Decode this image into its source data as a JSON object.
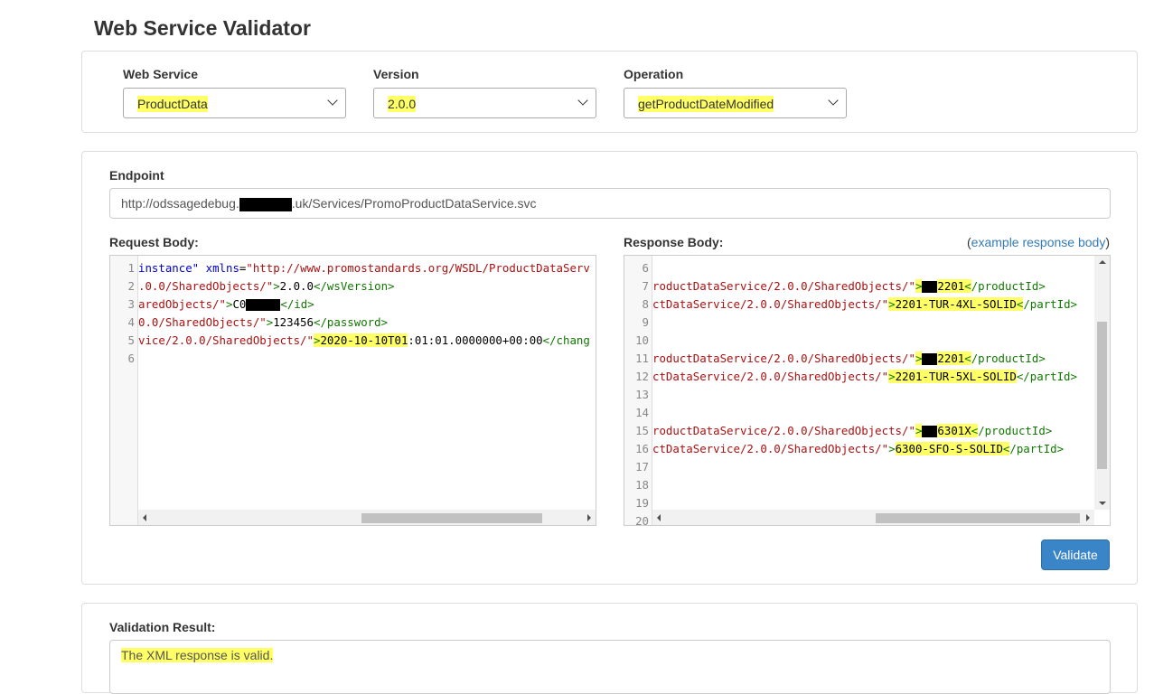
{
  "page": {
    "title": "Web Service Validator"
  },
  "service": {
    "web_service_label": "Web Service",
    "web_service_value": "ProductData",
    "version_label": "Version",
    "version_value": "2.0.0",
    "operation_label": "Operation",
    "operation_value": "getProductDateModified"
  },
  "endpoint": {
    "label": "Endpoint",
    "value_prefix": "http://odssagedebug.",
    "value_suffix": ".uk/Services/PromoProductDataService.svc"
  },
  "request": {
    "label": "Request Body:",
    "lines": [
      {
        "n": "1",
        "parts": [
          {
            "c": "t-attr",
            "t": "instance\" "
          },
          {
            "c": "t-attr",
            "t": "xmlns"
          },
          {
            "c": "t-text",
            "t": "="
          },
          {
            "c": "t-str",
            "t": "\"http://www.promostandards.org/WSDL/ProductDataServ"
          }
        ]
      },
      {
        "n": "2",
        "parts": [
          {
            "c": "t-str",
            "t": ".0.0/SharedObjects/\""
          },
          {
            "c": "t-tag",
            "t": ">"
          },
          {
            "c": "t-text",
            "t": "2.0.0"
          },
          {
            "c": "t-tag",
            "t": "</wsVersion>"
          }
        ]
      },
      {
        "n": "3",
        "parts": [
          {
            "c": "t-str",
            "t": "aredObjects/\""
          },
          {
            "c": "t-tag",
            "t": ">"
          },
          {
            "c": "t-text",
            "t": "C0"
          },
          {
            "c": "redact",
            "t": ""
          },
          {
            "c": "t-tag",
            "t": "</id>"
          }
        ]
      },
      {
        "n": "4",
        "parts": [
          {
            "c": "t-str",
            "t": "0.0/SharedObjects/\""
          },
          {
            "c": "t-tag",
            "t": ">"
          },
          {
            "c": "t-text",
            "t": "123456"
          },
          {
            "c": "t-tag",
            "t": "</password>"
          }
        ]
      },
      {
        "n": "5",
        "parts": [
          {
            "c": "t-str",
            "t": "vice/2.0.0/SharedObjects/\""
          },
          {
            "c": "t-tag hl",
            "t": ">"
          },
          {
            "c": "t-text hl",
            "t": "2020-10-10T01"
          },
          {
            "c": "t-text",
            "t": ":01:01.0000000+00:00"
          },
          {
            "c": "t-tag",
            "t": "</chang"
          }
        ]
      },
      {
        "n": "6",
        "parts": []
      }
    ]
  },
  "response": {
    "label": "Response Body:",
    "link_open": "(",
    "link_text": "example response body",
    "link_close": ")",
    "lines": [
      {
        "n": "6",
        "parts": []
      },
      {
        "n": "7",
        "parts": [
          {
            "c": "t-str",
            "t": "roductDataService/2.0.0/SharedObjects/\""
          },
          {
            "c": "t-tag hl",
            "t": ">"
          },
          {
            "c": "redact",
            "t": ""
          },
          {
            "c": "t-text hl",
            "t": "2201"
          },
          {
            "c": "t-tag hl",
            "t": "<"
          },
          {
            "c": "t-tag",
            "t": "/productId>"
          }
        ]
      },
      {
        "n": "8",
        "parts": [
          {
            "c": "t-str",
            "t": "ctDataService/2.0.0/SharedObjects/\""
          },
          {
            "c": "t-tag hl",
            "t": ">"
          },
          {
            "c": "t-text hl",
            "t": "2201-TUR-4XL-SOLID"
          },
          {
            "c": "t-tag hl",
            "t": "<"
          },
          {
            "c": "t-tag",
            "t": "/partId>"
          }
        ]
      },
      {
        "n": "9",
        "parts": []
      },
      {
        "n": "10",
        "parts": []
      },
      {
        "n": "11",
        "parts": [
          {
            "c": "t-str",
            "t": "roductDataService/2.0.0/SharedObjects/\""
          },
          {
            "c": "t-tag hl",
            "t": ">"
          },
          {
            "c": "redact",
            "t": ""
          },
          {
            "c": "t-text hl",
            "t": "2201"
          },
          {
            "c": "t-tag hl",
            "t": "<"
          },
          {
            "c": "t-tag",
            "t": "/productId>"
          }
        ]
      },
      {
        "n": "12",
        "parts": [
          {
            "c": "t-str",
            "t": "ctDataService/2.0.0/SharedObjects/\""
          },
          {
            "c": "t-tag hl",
            "t": ">"
          },
          {
            "c": "t-text hl",
            "t": "2201-TUR-5XL-SOLID"
          },
          {
            "c": "t-tag",
            "t": "</partId>"
          }
        ]
      },
      {
        "n": "13",
        "parts": []
      },
      {
        "n": "14",
        "parts": []
      },
      {
        "n": "15",
        "parts": [
          {
            "c": "t-str",
            "t": "roductDataService/2.0.0/SharedObjects/\""
          },
          {
            "c": "t-tag hl",
            "t": ">"
          },
          {
            "c": "redact",
            "t": ""
          },
          {
            "c": "t-text hl",
            "t": "6301X"
          },
          {
            "c": "t-tag hl",
            "t": "<"
          },
          {
            "c": "t-tag",
            "t": "/productId>"
          }
        ]
      },
      {
        "n": "16",
        "parts": [
          {
            "c": "t-str",
            "t": "ctDataService/2.0.0/SharedObjects/\""
          },
          {
            "c": "t-tag",
            "t": ">"
          },
          {
            "c": "t-text hl",
            "t": "6300-SFO-S-SOLID"
          },
          {
            "c": "t-tag hl",
            "t": "<"
          },
          {
            "c": "t-tag",
            "t": "/partId>"
          }
        ]
      },
      {
        "n": "17",
        "parts": []
      },
      {
        "n": "18",
        "parts": []
      },
      {
        "n": "19",
        "parts": []
      },
      {
        "n": "20",
        "parts": []
      }
    ]
  },
  "actions": {
    "validate_label": "Validate"
  },
  "result": {
    "label": "Validation Result:",
    "value": "The XML response is valid."
  },
  "colors": {
    "highlight": "#ffff66",
    "button": "#3a85c7",
    "link": "#337ab7"
  }
}
